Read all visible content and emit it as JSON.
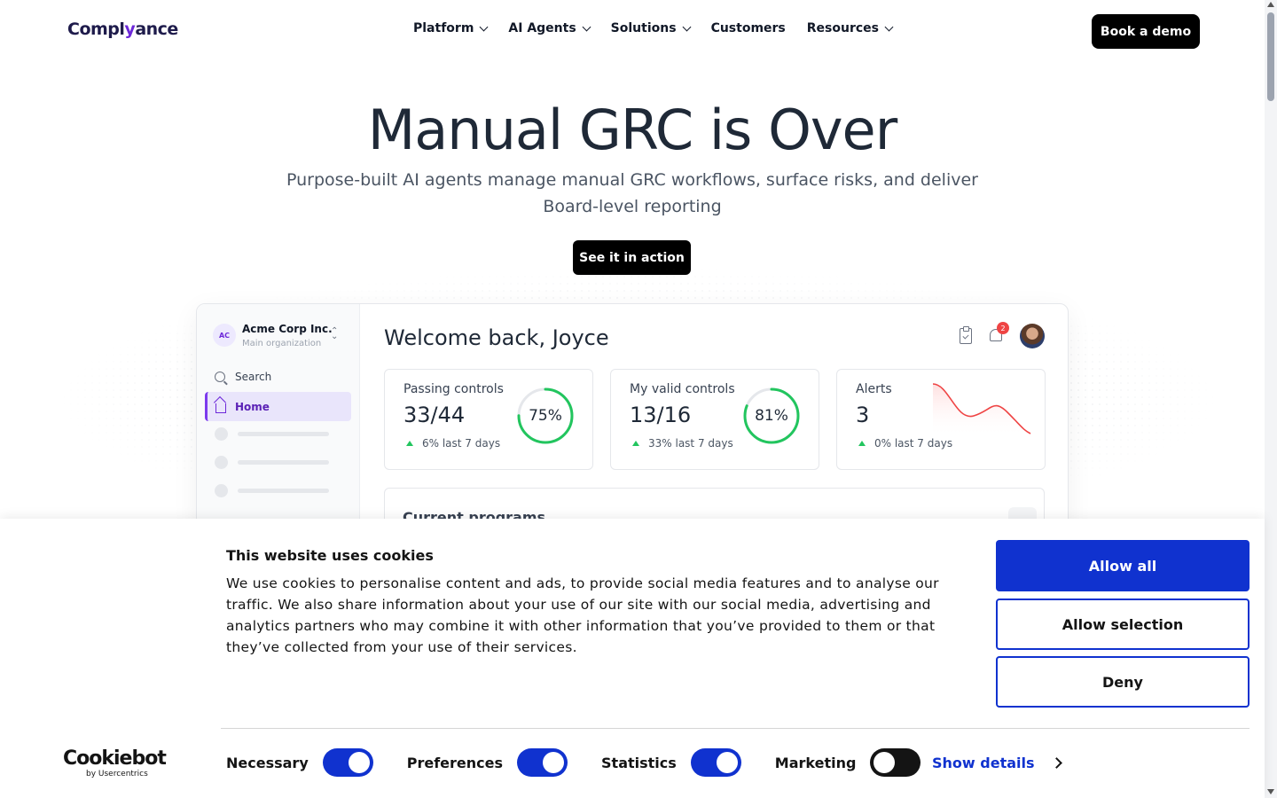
{
  "header": {
    "logo_text_a": "Compl",
    "logo_text_y": "y",
    "logo_text_b": "ance",
    "nav": [
      {
        "label": "Platform",
        "has_dropdown": true
      },
      {
        "label": "AI Agents",
        "has_dropdown": true
      },
      {
        "label": "Solutions",
        "has_dropdown": true
      },
      {
        "label": "Customers",
        "has_dropdown": false
      },
      {
        "label": "Resources",
        "has_dropdown": true
      }
    ],
    "cta": "Book a demo"
  },
  "hero": {
    "title": "Manual GRC is Over",
    "subtitle": "Purpose-built AI agents manage manual GRC workflows, surface risks, and deliver Board-level reporting",
    "cta": "See it in action"
  },
  "dashboard": {
    "org": {
      "initials": "AC",
      "name": "Acme Corp Inc.",
      "sub": "Main organization"
    },
    "search_label": "Search",
    "home_label": "Home",
    "welcome": "Welcome back, Joyce",
    "notifications_count": "2",
    "cards": [
      {
        "title": "Passing controls",
        "value": "33/44",
        "delta": "6% last 7 days",
        "percent_label": "75%",
        "percent": 75,
        "color": "#22c55e"
      },
      {
        "title": "My valid controls",
        "value": "13/16",
        "delta": "33% last 7 days",
        "percent_label": "81%",
        "percent": 81,
        "color": "#22c55e"
      },
      {
        "title": "Alerts",
        "value": "3",
        "delta": "0% last 7 days",
        "trend_color": "#ef4444"
      }
    ],
    "programs_title": "Current programs"
  },
  "cookie": {
    "title": "This website uses cookies",
    "text": "We use cookies to personalise content and ads, to provide social media features and to analyse our traffic. We also share information about your use of our site with our social media, advertising and analytics partners who may combine it with other information that you’ve provided to them or that they’ve collected from your use of their services.",
    "allow_all": "Allow all",
    "allow_selection": "Allow selection",
    "deny": "Deny",
    "toggles": [
      {
        "label": "Necessary",
        "on": true
      },
      {
        "label": "Preferences",
        "on": true
      },
      {
        "label": "Statistics",
        "on": true
      },
      {
        "label": "Marketing",
        "on": false
      }
    ],
    "show_details": "Show details",
    "brand": "Cookiebot",
    "brand_sub": "by Usercentrics",
    "accent_color": "#1032cf"
  }
}
